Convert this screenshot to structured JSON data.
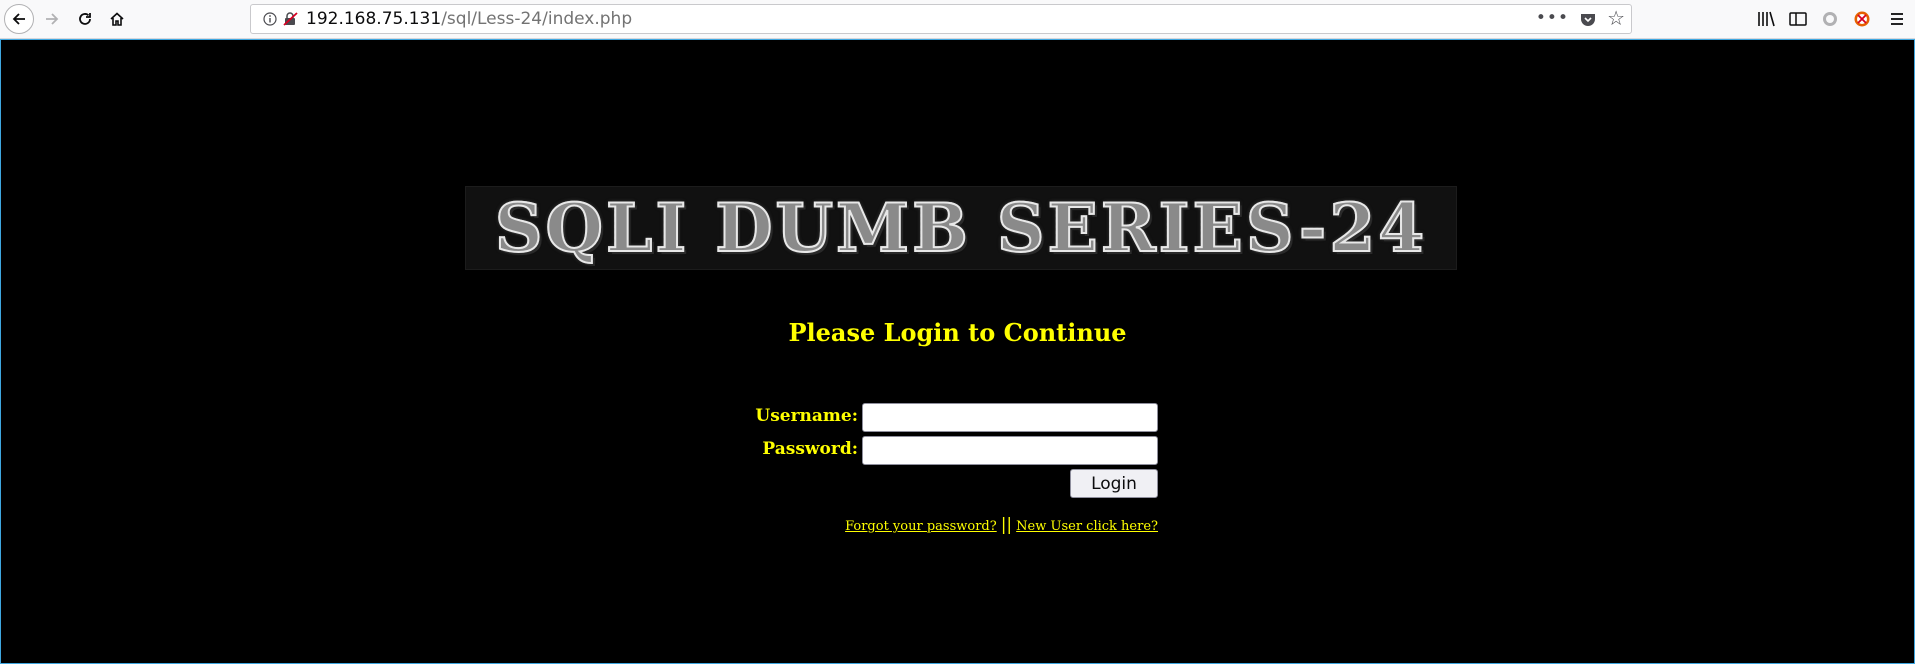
{
  "browser": {
    "url_host": "192.168.75.131",
    "url_path": "/sql/Less-24/index.php",
    "overflow_menu": "•••"
  },
  "page": {
    "banner_text": "SQLI DUMB SERIES-24",
    "heading": "Please Login to Continue",
    "username_label": "Username:",
    "password_label": "Password:",
    "username_value": "",
    "password_value": "",
    "login_button": "Login",
    "forgot_link": "Forgot your password?",
    "separator": "||",
    "new_user_link": "New User click here?"
  },
  "colors": {
    "page_background": "#000000",
    "text_accent": "#ffff00",
    "frame_border": "#3fa7e0"
  },
  "icons": [
    "back-icon",
    "forward-icon",
    "reload-icon",
    "home-icon",
    "info-icon",
    "insecure-lock-icon",
    "pocket-icon",
    "star-icon",
    "library-icon",
    "sidebar-icon",
    "sync-icon",
    "addon-icon",
    "menu-icon"
  ]
}
